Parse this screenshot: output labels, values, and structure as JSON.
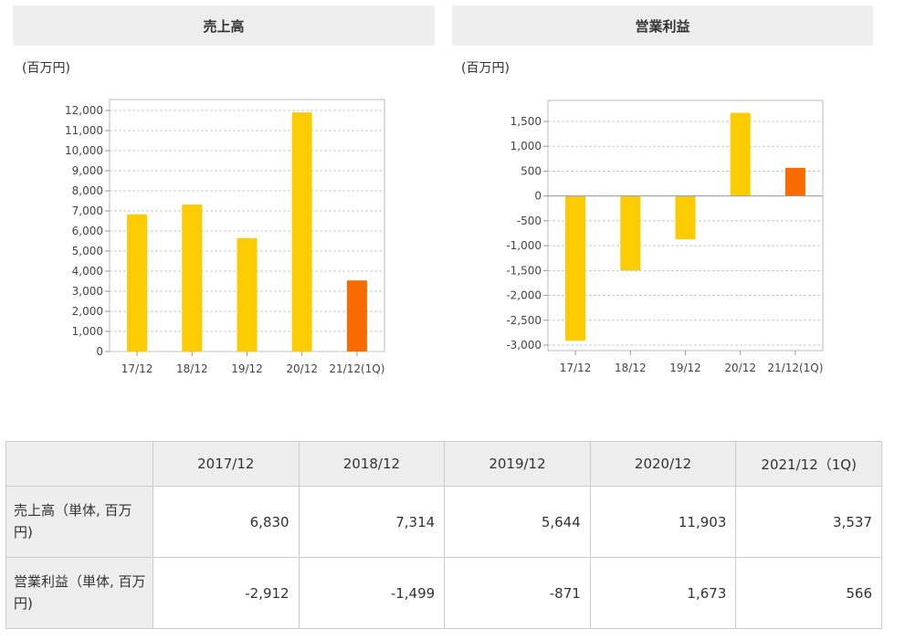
{
  "charts": {
    "left": {
      "header": "売上高",
      "unit": "(百万円)"
    },
    "right": {
      "header": "営業利益",
      "unit": "(百万円)"
    }
  },
  "chart_data": [
    {
      "type": "bar",
      "title": "売上高",
      "ylabel": "(百万円)",
      "categories": [
        "17/12",
        "18/12",
        "19/12",
        "20/12",
        "21/12(1Q)"
      ],
      "values": [
        6830,
        7314,
        5644,
        11903,
        3537
      ],
      "ylim": [
        0,
        12000
      ],
      "yticks": [
        0,
        1000,
        2000,
        3000,
        4000,
        5000,
        6000,
        7000,
        8000,
        9000,
        10000,
        11000,
        12000
      ],
      "grid": true,
      "colors": {
        "default": "#fccb00",
        "highlight": "#f76b00"
      },
      "highlight_index": 4
    },
    {
      "type": "bar",
      "title": "営業利益",
      "ylabel": "(百万円)",
      "categories": [
        "17/12",
        "18/12",
        "19/12",
        "20/12",
        "21/12(1Q)"
      ],
      "values": [
        -2912,
        -1499,
        -871,
        1673,
        566
      ],
      "ylim": [
        -3000,
        1500
      ],
      "yticks": [
        -3000,
        -2500,
        -2000,
        -1500,
        -1000,
        -500,
        0,
        500,
        1000,
        1500
      ],
      "grid": true,
      "colors": {
        "default": "#fccb00",
        "highlight": "#f76b00"
      },
      "highlight_index": 4
    }
  ],
  "table": {
    "columns": [
      "2017/12",
      "2018/12",
      "2019/12",
      "2020/12",
      "2021/12（1Q)"
    ],
    "rows": [
      {
        "label": "売上高（単体, 百万円)",
        "values": [
          "6,830",
          "7,314",
          "5,644",
          "11,903",
          "3,537"
        ]
      },
      {
        "label": "営業利益（単体, 百万円)",
        "values": [
          "-2,912",
          "-1,499",
          "-871",
          "1,673",
          "566"
        ]
      }
    ]
  }
}
